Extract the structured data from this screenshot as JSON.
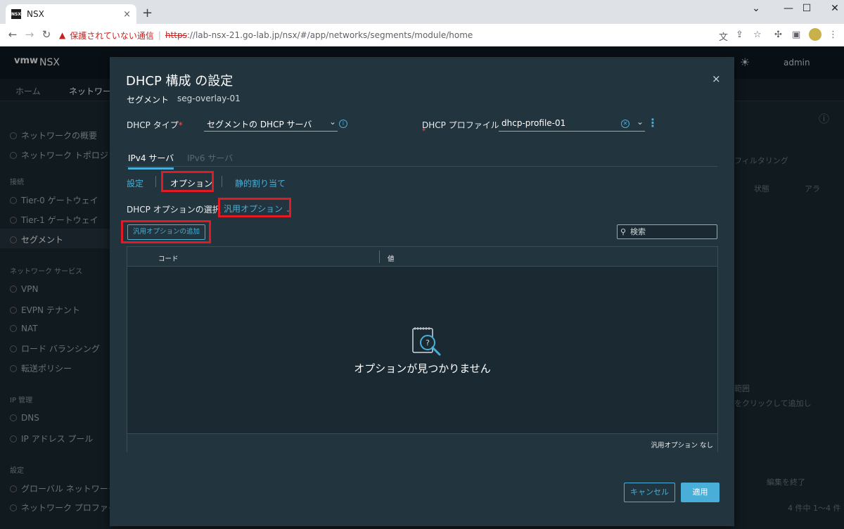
{
  "browser": {
    "tab_title": "NSX",
    "favicon_text": "NSX",
    "tab_close": "×",
    "new_tab": "+",
    "security_warning": "保護されていない通信",
    "url_scheme": "https",
    "url_rest": "://lab-nsx-21.go-lab.jp/nsx/#/app/networks/segments/module/home"
  },
  "app": {
    "logo": "vmw",
    "title": "NSX",
    "user": "admin",
    "nav_tabs": [
      "ホーム",
      "ネットワーク"
    ],
    "sidebar": {
      "items_top": [
        "ネットワークの概要",
        "ネットワーク トポロジ"
      ],
      "section_connectivity": "接続",
      "connectivity": [
        "Tier-0 ゲートウェイ",
        "Tier-1 ゲートウェイ",
        "セグメント"
      ],
      "section_services": "ネットワーク サービス",
      "services": [
        "VPN",
        "EVPN テナント",
        "NAT",
        "ロード バランシング",
        "転送ポリシー"
      ],
      "section_ip": "IP 管理",
      "ip": [
        "DNS",
        "IP アドレス プール"
      ],
      "section_settings": "設定",
      "settings": [
        "グローバル ネットワーク",
        "ネットワーク プロファイル"
      ]
    },
    "bg_right": {
      "filter": "フィルタリング",
      "status_col": "状態",
      "alarm_col": "アラ",
      "range": "範囲",
      "hint": "をクリックして追加し",
      "finish_edit": "編集を終了",
      "count": "4 件中 1～4 件"
    }
  },
  "modal": {
    "title": "DHCP 構成 の設定",
    "close": "×",
    "segment_label": "セグメント",
    "segment_value": "seg-overlay-01",
    "dhcp_type_label": "DHCP タイプ",
    "dhcp_type_value": "セグメントの DHCP サーバ",
    "dhcp_profile_label": "DHCP プロファイル",
    "dhcp_profile_value": "dhcp-profile-01",
    "ip_tabs": [
      "IPv4 サーバ",
      "IPv6 サーバ"
    ],
    "sub_tabs": [
      "設定",
      "オプション",
      "静的割り当て"
    ],
    "option_select_label": "DHCP オプションの選択",
    "option_select_value": "汎用オプション",
    "add_button": "汎用オプションの追加",
    "search_placeholder": "検索",
    "columns": [
      "コード",
      "値"
    ],
    "empty_text": "オプションが見つかりません",
    "footer_text": "汎用オプション なし",
    "cancel": "キャンセル",
    "apply": "適用"
  },
  "colors": {
    "accent": "#49afd9",
    "highlight": "#e01b24",
    "modal_bg": "#22343d"
  }
}
